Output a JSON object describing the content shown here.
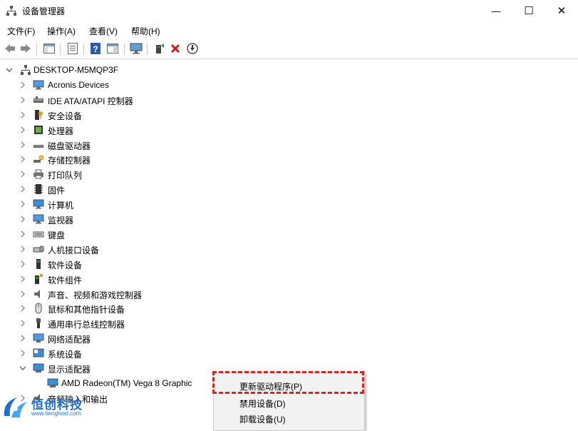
{
  "window": {
    "title": "设备管理器",
    "minimize_glyph": "—",
    "maximize_glyph": "☐",
    "close_glyph": "✕"
  },
  "menu": [
    {
      "label": "文件(F)"
    },
    {
      "label": "操作(A)"
    },
    {
      "label": "查看(V)"
    },
    {
      "label": "帮助(H)"
    }
  ],
  "toolbar": {
    "icons": [
      "back-icon",
      "forward-icon",
      "show-hide-console-tree-icon",
      "properties-icon",
      "help-icon",
      "view-icon",
      "monitor-icon",
      "update-driver-icon",
      "uninstall-icon",
      "enable-device-icon"
    ]
  },
  "tree": {
    "root": "DESKTOP-M5MQP3F",
    "categories": [
      {
        "label": "Acronis Devices",
        "icon": "monitor-icon"
      },
      {
        "label": "IDE ATA/ATAPI 控制器",
        "icon": "ide-controller-icon"
      },
      {
        "label": "安全设备",
        "icon": "security-device-icon"
      },
      {
        "label": "处理器",
        "icon": "processor-icon"
      },
      {
        "label": "磁盘驱动器",
        "icon": "disk-drive-icon"
      },
      {
        "label": "存储控制器",
        "icon": "storage-controller-icon"
      },
      {
        "label": "打印队列",
        "icon": "printer-icon"
      },
      {
        "label": "固件",
        "icon": "firmware-icon"
      },
      {
        "label": "计算机",
        "icon": "computer-icon"
      },
      {
        "label": "监视器",
        "icon": "monitor-icon"
      },
      {
        "label": "键盘",
        "icon": "keyboard-icon"
      },
      {
        "label": "人机接口设备",
        "icon": "hid-icon"
      },
      {
        "label": "软件设备",
        "icon": "software-device-icon"
      },
      {
        "label": "软件组件",
        "icon": "software-component-icon"
      },
      {
        "label": "声音、视频和游戏控制器",
        "icon": "speaker-icon"
      },
      {
        "label": "鼠标和其他指针设备",
        "icon": "mouse-icon"
      },
      {
        "label": "通用串行总线控制器",
        "icon": "usb-icon"
      },
      {
        "label": "网络适配器",
        "icon": "network-adapter-icon"
      },
      {
        "label": "系统设备",
        "icon": "system-device-icon"
      },
      {
        "label": "显示适配器",
        "icon": "display-adapter-icon",
        "expanded": true
      },
      {
        "label": "音频输入和输出",
        "icon": "audio-io-icon"
      }
    ],
    "display_child": "AMD Radeon(TM) Vega 8 Graphic"
  },
  "context_menu": {
    "items": [
      {
        "label": "更新驱动程序(P)"
      },
      {
        "label": "禁用设备(D)"
      },
      {
        "label": "卸载设备(U)"
      }
    ],
    "highlight_color": "#d9261c"
  },
  "watermark": {
    "text": "恒创科技",
    "url": "www.henghost.com",
    "color": "#1e6fd0"
  }
}
